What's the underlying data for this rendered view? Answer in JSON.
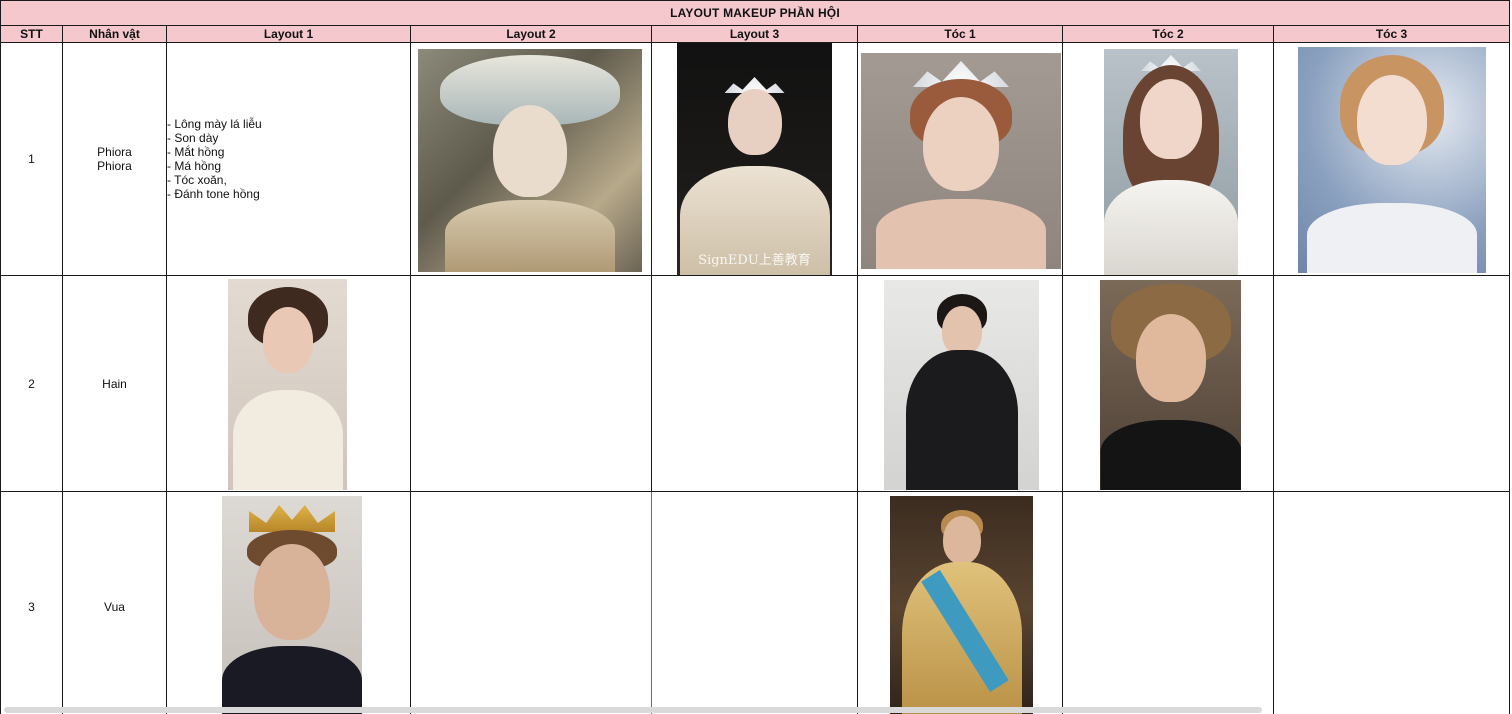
{
  "sheet": {
    "title": "LAYOUT MAKEUP PHẦN HỘI",
    "headers": [
      "STT",
      "Nhân vật",
      "Layout 1",
      "Layout 2",
      "Layout 3",
      "Tóc 1",
      "Tóc 2",
      "Tóc 3"
    ],
    "rows": [
      {
        "stt": "1",
        "name_lines": [
          "Phiora",
          "Phiora"
        ],
        "layout1_notes": [
          "- Lông mày lá liễu",
          "- Son dày",
          "- Mắt hồng",
          "- Má hồng",
          "- Tóc xoăn,",
          "- Đánh tone hồng"
        ],
        "layout3_watermark": "SignEDU上善教育"
      },
      {
        "stt": "2",
        "name": "Hain"
      },
      {
        "stt": "3",
        "name": "Vua"
      }
    ]
  },
  "images": [
    "avant-garde-makeup-photo",
    "bridal-veil-photo",
    "floral-crown-updo-photo",
    "tiara-waves-photo",
    "golden-updo-photo",
    "curly-hair-man-photo",
    "black-coat-man-photo",
    "shaggy-hair-man-photo",
    "king-crown-photo",
    "royal-costume-photo"
  ]
}
